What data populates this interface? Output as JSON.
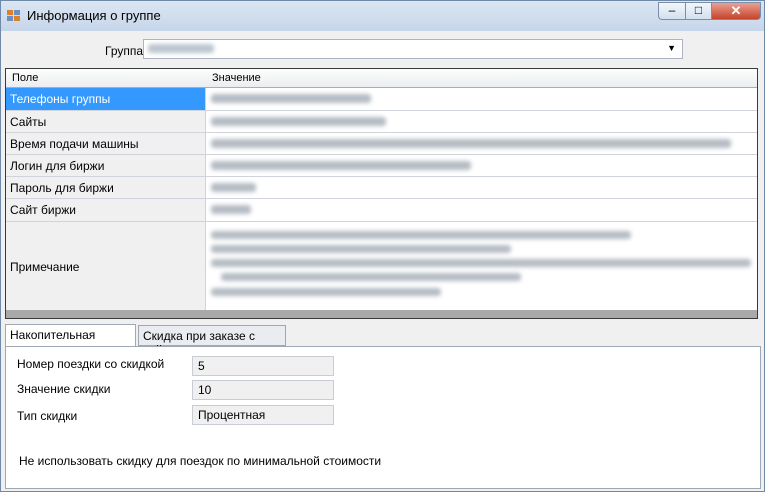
{
  "window": {
    "title": "Информация о группе",
    "controls": {
      "minimize": "–",
      "maximize": "□",
      "close": "✕"
    }
  },
  "group": {
    "label": "Группа",
    "value": ""
  },
  "grid": {
    "headers": [
      "Поле",
      "Значение"
    ],
    "rows": [
      {
        "field": "Телефоны группы",
        "selected": true
      },
      {
        "field": "Сайты"
      },
      {
        "field": "Время подачи машины"
      },
      {
        "field": "Логин для биржи"
      },
      {
        "field": "Пароль для биржи"
      },
      {
        "field": "Сайт биржи"
      },
      {
        "field": "Примечание"
      }
    ]
  },
  "tabs": [
    "Накопительная скидка",
    "Скидка при заказе с сайта"
  ],
  "discount": {
    "trip_label": "Номер поездки со скидкой",
    "trip_value": "5",
    "value_label": "Значение скидки",
    "value_value": "10",
    "type_label": "Тип скидки",
    "type_value": "Процентная",
    "note": "Не использовать скидку для поездок по минимальной стоимости"
  },
  "colors": {
    "selected_row": "#3399ff",
    "titlebar": "#c6d6ea",
    "close_button": "#c7432a"
  }
}
